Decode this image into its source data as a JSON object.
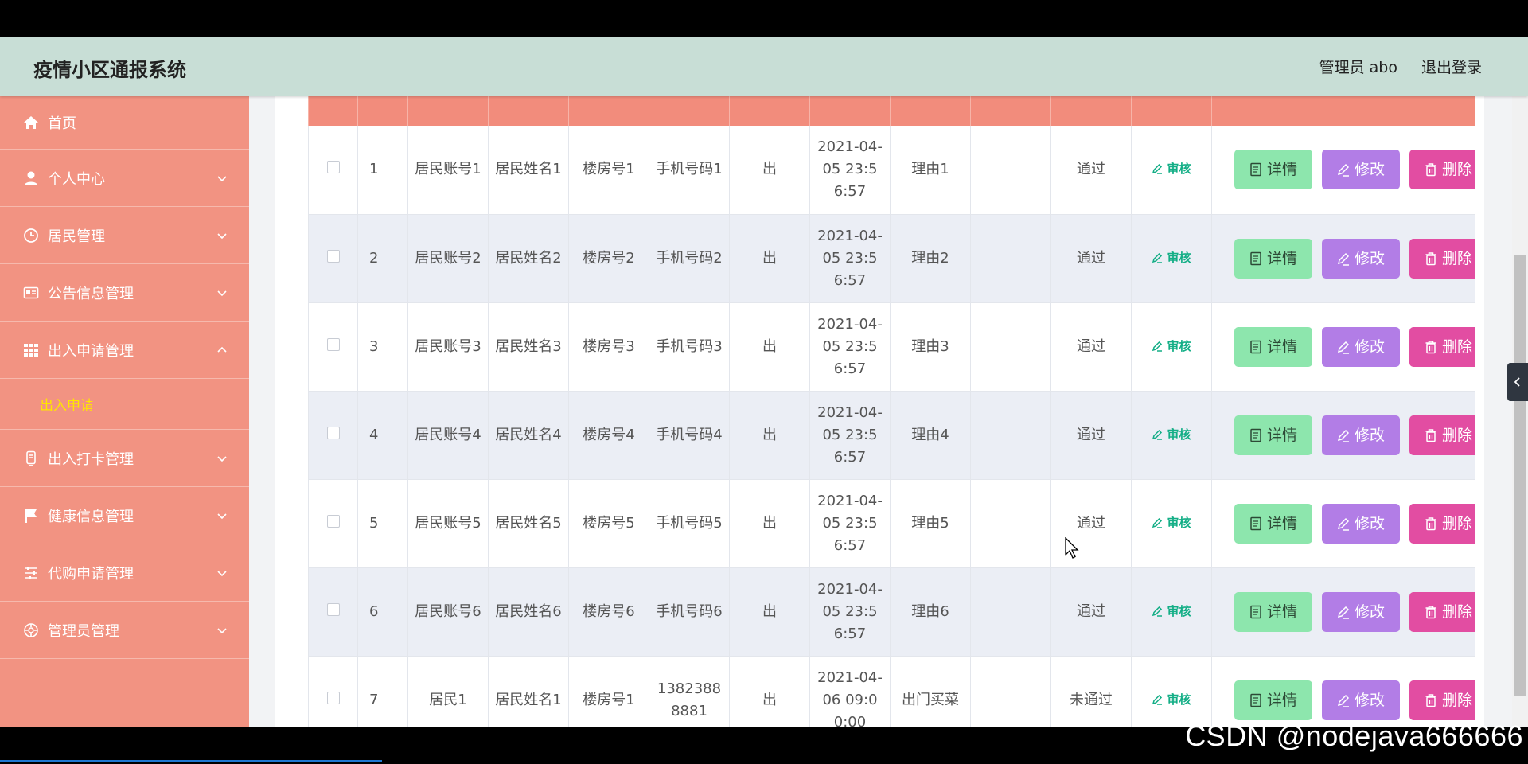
{
  "header": {
    "title": "疫情小区通报系统",
    "user_label": "管理员 abo",
    "logout_label": "退出登录"
  },
  "sidebar": {
    "items": [
      {
        "label": "首页",
        "icon": "home-icon"
      },
      {
        "label": "个人中心",
        "icon": "user-icon"
      },
      {
        "label": "居民管理",
        "icon": "clock-icon"
      },
      {
        "label": "公告信息管理",
        "icon": "card-icon"
      },
      {
        "label": "出入申请管理",
        "icon": "grid-icon"
      },
      {
        "label": "出入打卡管理",
        "icon": "badge-icon"
      },
      {
        "label": "健康信息管理",
        "icon": "flag-icon"
      },
      {
        "label": "代购申请管理",
        "icon": "sliders-icon"
      },
      {
        "label": "管理员管理",
        "icon": "target-icon"
      }
    ],
    "submenu": {
      "label": "出入申请"
    }
  },
  "table": {
    "rows": [
      {
        "index": "1",
        "account": "居民账号1",
        "name": "居民姓名1",
        "building": "楼房号1",
        "phone": "手机号码1",
        "direction": "出",
        "time": "2021-04-05 23:56:57",
        "reason": "理由1",
        "reply": "",
        "status": "通过"
      },
      {
        "index": "2",
        "account": "居民账号2",
        "name": "居民姓名2",
        "building": "楼房号2",
        "phone": "手机号码2",
        "direction": "出",
        "time": "2021-04-05 23:56:57",
        "reason": "理由2",
        "reply": "",
        "status": "通过"
      },
      {
        "index": "3",
        "account": "居民账号3",
        "name": "居民姓名3",
        "building": "楼房号3",
        "phone": "手机号码3",
        "direction": "出",
        "time": "2021-04-05 23:56:57",
        "reason": "理由3",
        "reply": "",
        "status": "通过"
      },
      {
        "index": "4",
        "account": "居民账号4",
        "name": "居民姓名4",
        "building": "楼房号4",
        "phone": "手机号码4",
        "direction": "出",
        "time": "2021-04-05 23:56:57",
        "reason": "理由4",
        "reply": "",
        "status": "通过"
      },
      {
        "index": "5",
        "account": "居民账号5",
        "name": "居民姓名5",
        "building": "楼房号5",
        "phone": "手机号码5",
        "direction": "出",
        "time": "2021-04-05 23:56:57",
        "reason": "理由5",
        "reply": "",
        "status": "通过"
      },
      {
        "index": "6",
        "account": "居民账号6",
        "name": "居民姓名6",
        "building": "楼房号6",
        "phone": "手机号码6",
        "direction": "出",
        "time": "2021-04-05 23:56:57",
        "reason": "理由6",
        "reply": "",
        "status": "通过"
      },
      {
        "index": "7",
        "account": "居民1",
        "name": "居民姓名1",
        "building": "楼房号1",
        "phone": "13823888881",
        "direction": "出",
        "time": "2021-04-06 09:00:00",
        "reason": "出门买菜",
        "reply": "",
        "status": "未通过"
      }
    ],
    "audit_label": "审核",
    "detail_label": "详情",
    "edit_label": "修改",
    "delete_label": "删除"
  },
  "watermark": "CSDN @nodejava666666",
  "colors": {
    "header_bg": "#c8ded6",
    "sidebar_bg": "#f29382",
    "submenu_active": "#ffe600",
    "table_header": "#f28c7c",
    "audit": "#13ae86",
    "detail_btn": "#8de6ad",
    "edit_btn": "#b27de6",
    "delete_btn": "#e24da2"
  }
}
